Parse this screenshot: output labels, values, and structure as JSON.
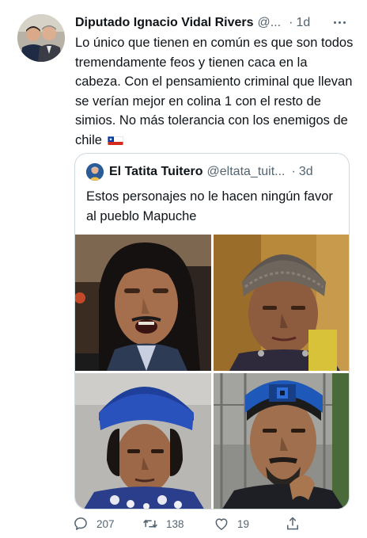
{
  "tweet": {
    "author_name": "Diputado Ignacio Vidal Rivers",
    "author_handle": "@...",
    "separator": "·",
    "time": "1d",
    "text": "Lo único que tienen en común es que son todos tremendamente feos y tienen caca en la cabeza. Con el pensamiento criminal que llevan se verían mejor en colina 1 con el resto de simios. No más tolerancia con los enemigos de chile",
    "flag_icon": "chile-flag-icon",
    "more_icon": "more-dots-icon"
  },
  "quote": {
    "author_name": "El Tatita Tuitero",
    "author_handle": "@eltata_tuit...",
    "separator": "·",
    "time": "3d",
    "text": "Estos personajes no le hacen ningún favor al pueblo Mapuche",
    "photos": [
      "photo-1",
      "photo-2",
      "photo-3",
      "photo-4"
    ]
  },
  "actions": {
    "reply_count": "207",
    "retweet_count": "138",
    "like_count": "19",
    "icons": [
      "reply-icon",
      "retweet-icon",
      "like-icon",
      "share-icon"
    ]
  },
  "colors": {
    "text": "#0f1419",
    "secondary": "#536471",
    "border": "#cfd9de"
  }
}
